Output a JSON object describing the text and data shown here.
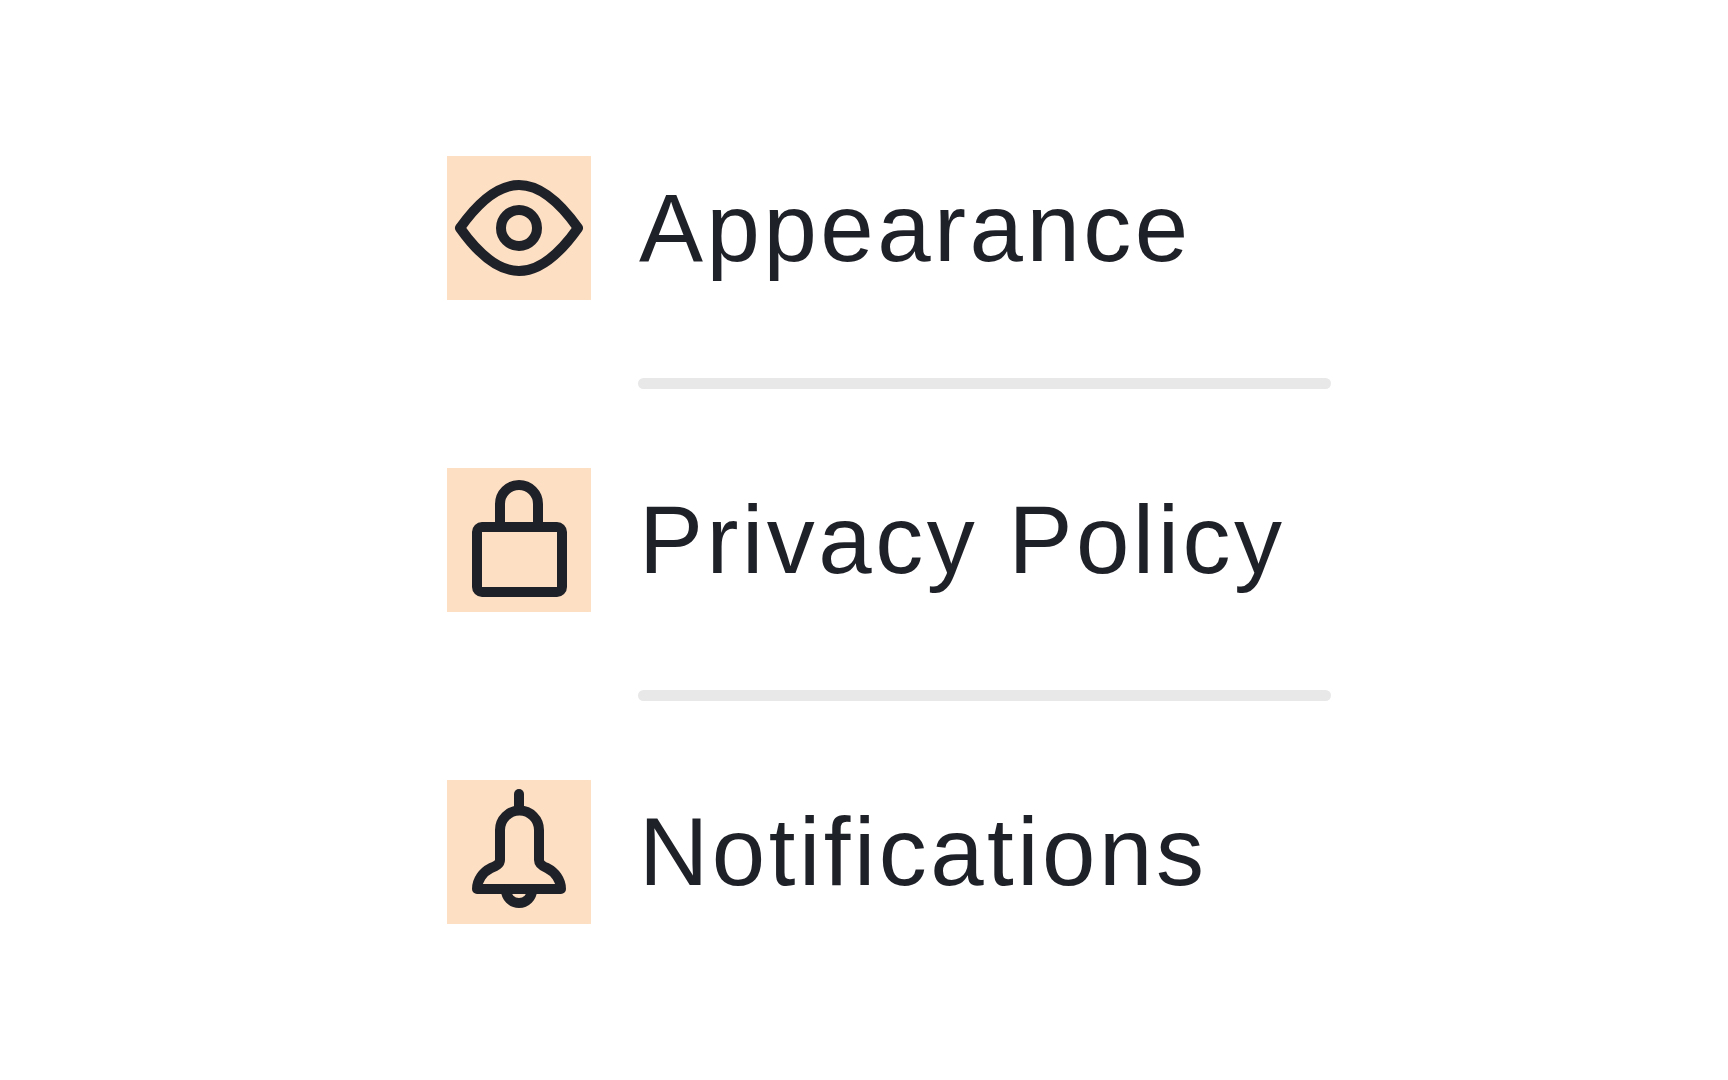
{
  "menu": {
    "items": [
      {
        "kind": "eye",
        "label": "Appearance"
      },
      {
        "kind": "lock",
        "label": "Privacy Policy"
      },
      {
        "kind": "bell",
        "label": "Notifications"
      }
    ]
  }
}
